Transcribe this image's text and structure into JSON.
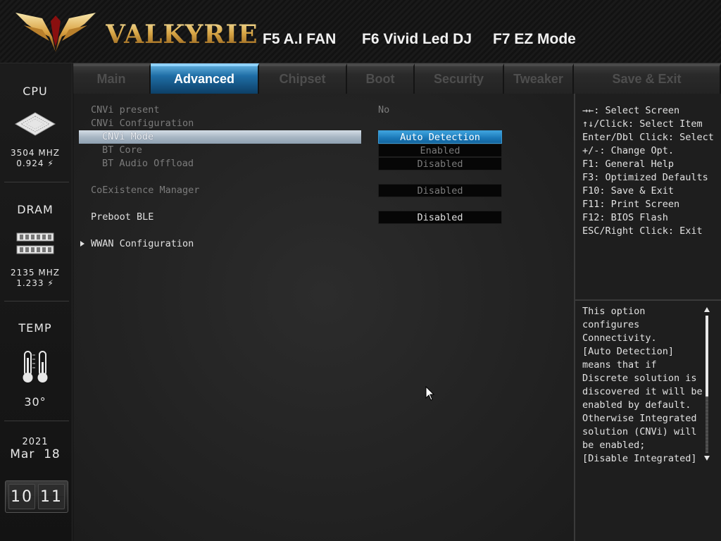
{
  "brand": {
    "name": "VALKYRIE"
  },
  "header": {
    "fkeys": [
      {
        "label": "F5 A.I FAN"
      },
      {
        "label": "F6 Vivid Led DJ"
      },
      {
        "label": "F7 EZ Mode"
      }
    ]
  },
  "sidebar": {
    "cpu": {
      "title": "CPU",
      "freq": "3504 MHZ",
      "volt": "0.924 ⚡"
    },
    "dram": {
      "title": "DRAM",
      "freq": "2135 MHZ",
      "volt": "1.233 ⚡"
    },
    "temp": {
      "title": "TEMP",
      "value": "30°"
    },
    "date": {
      "year": "2021",
      "month_day": "Mar  18"
    },
    "time": {
      "hours": "10",
      "minutes": "11"
    }
  },
  "tabs": [
    {
      "label": "Main",
      "active": false
    },
    {
      "label": "Advanced",
      "active": true
    },
    {
      "label": "Chipset",
      "active": false
    },
    {
      "label": "Boot",
      "active": false
    },
    {
      "label": "Security",
      "active": false
    },
    {
      "label": "Tweaker",
      "active": false
    },
    {
      "label": "Save & Exit",
      "active": false
    }
  ],
  "settings": {
    "cnvi_present": {
      "label": "CNVi present",
      "value": "No"
    },
    "cnvi_config": {
      "label": "CNVi Configuration"
    },
    "cnvi_mode": {
      "label": "CNVi Mode",
      "value": "Auto Detection"
    },
    "bt_core": {
      "label": "BT Core",
      "value": "Enabled"
    },
    "bt_audio": {
      "label": "BT Audio Offload",
      "value": "Disabled"
    },
    "coexistence": {
      "label": "CoExistence Manager",
      "value": "Disabled"
    },
    "preboot_ble": {
      "label": "Preboot BLE",
      "value": "Disabled"
    },
    "wwan": {
      "label": "WWAN Configuration"
    }
  },
  "keys_help": [
    "→←: Select Screen",
    "↑↓/Click: Select Item",
    "Enter/Dbl Click: Select",
    "+/-: Change Opt.",
    "F1: General Help",
    "F3: Optimized Defaults",
    "F10: Save & Exit",
    "F11: Print Screen",
    "F12: BIOS Flash",
    "ESC/Right Click: Exit"
  ],
  "help_text": [
    "This option",
    "configures",
    "Connectivity.",
    "[Auto Detection]",
    "means that if",
    "Discrete solution is",
    "discovered it will be",
    "enabled by default.",
    "Otherwise Integrated",
    "solution (CNVi) will",
    "be enabled;",
    "[Disable Integrated]"
  ],
  "colors": {
    "accent": "#1f78b8",
    "brand_gold": "#d9a94c",
    "selection": "#a9b7c4"
  },
  "icons": {
    "cpu": "cpu-chip-icon",
    "dram": "memory-module-icon",
    "temp": "thermometer-icon",
    "logo": "valkyrie-wing-logo",
    "cursor": "mouse-pointer-icon"
  }
}
